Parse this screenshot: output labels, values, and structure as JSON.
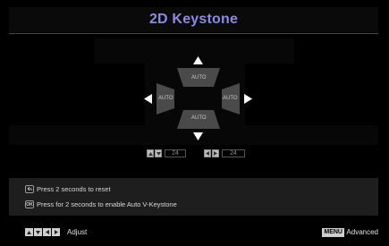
{
  "title": "2D Keystone",
  "keystone": {
    "top_label": "AUTO",
    "bottom_label": "AUTO",
    "left_label": "AUTO",
    "right_label": "AUTO",
    "vertical_value": "24",
    "horizontal_value": "24"
  },
  "hints": {
    "reset": "Press 2 seconds to reset",
    "auto_v": "Press for 2 seconds to enable Auto V-Keystone",
    "ok_icon": "OK"
  },
  "footer": {
    "adjust_label": "Adjust",
    "menu_key": "MENU",
    "advanced_label": "Advanced"
  },
  "colors": {
    "title": "#8a8be6",
    "trapezoid": "#4a4a4a",
    "info_panel": "#1e1e1e"
  }
}
